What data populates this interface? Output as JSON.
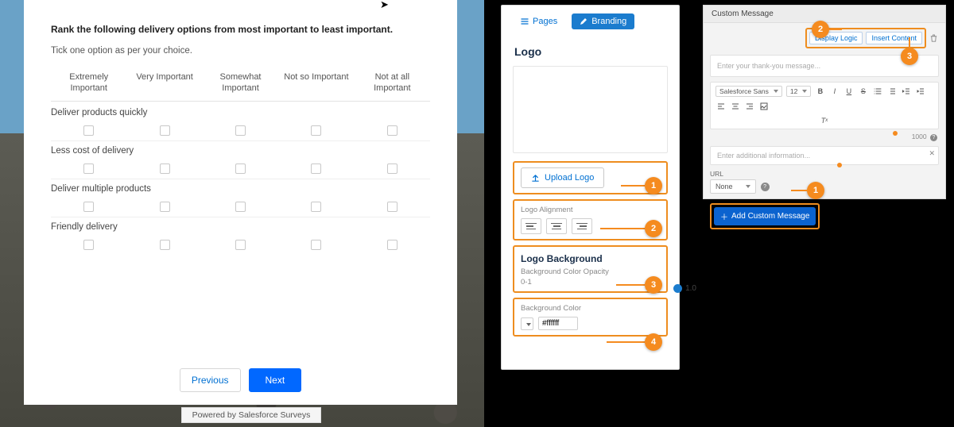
{
  "survey": {
    "question": "Rank the following delivery options from most important to least important.",
    "instruction": "Tick one option as per your choice.",
    "columns": [
      "Extremely\nImportant",
      "Very Important",
      "Somewhat\nImportant",
      "Not so Important",
      "Not at all\nImportant"
    ],
    "rows": [
      "Deliver products quickly",
      "Less cost of delivery",
      "Deliver multiple products",
      "Friendly delivery"
    ],
    "prev": "Previous",
    "next": "Next",
    "powered": "Powered by Salesforce Surveys"
  },
  "branding": {
    "tab_pages": "Pages",
    "tab_branding": "Branding",
    "heading": "Logo",
    "upload_btn": "Upload Logo",
    "alignment_label": "Logo Alignment",
    "bg_heading": "Logo Background",
    "opacity_label": "Background Color Opacity",
    "opacity_range": "0-1",
    "opacity_value": "1.0",
    "bgcolor_label": "Background Color",
    "bgcolor_value": "#ffffff",
    "callouts": {
      "1": "1",
      "2": "2",
      "3": "3",
      "4": "4"
    }
  },
  "custom": {
    "header": "Custom Message",
    "display_logic": "Display Logic",
    "insert_content": "Insert Content",
    "msg_placeholder": "Enter your thank-you message...",
    "font_family": "Salesforce Sans",
    "font_size": "12",
    "char_limit": "1000",
    "addl_placeholder": "Enter additional information...",
    "url_label": "URL",
    "url_value": "None",
    "add_btn": "Add Custom Message",
    "callouts": {
      "1": "1",
      "2": "2",
      "3": "3"
    }
  }
}
